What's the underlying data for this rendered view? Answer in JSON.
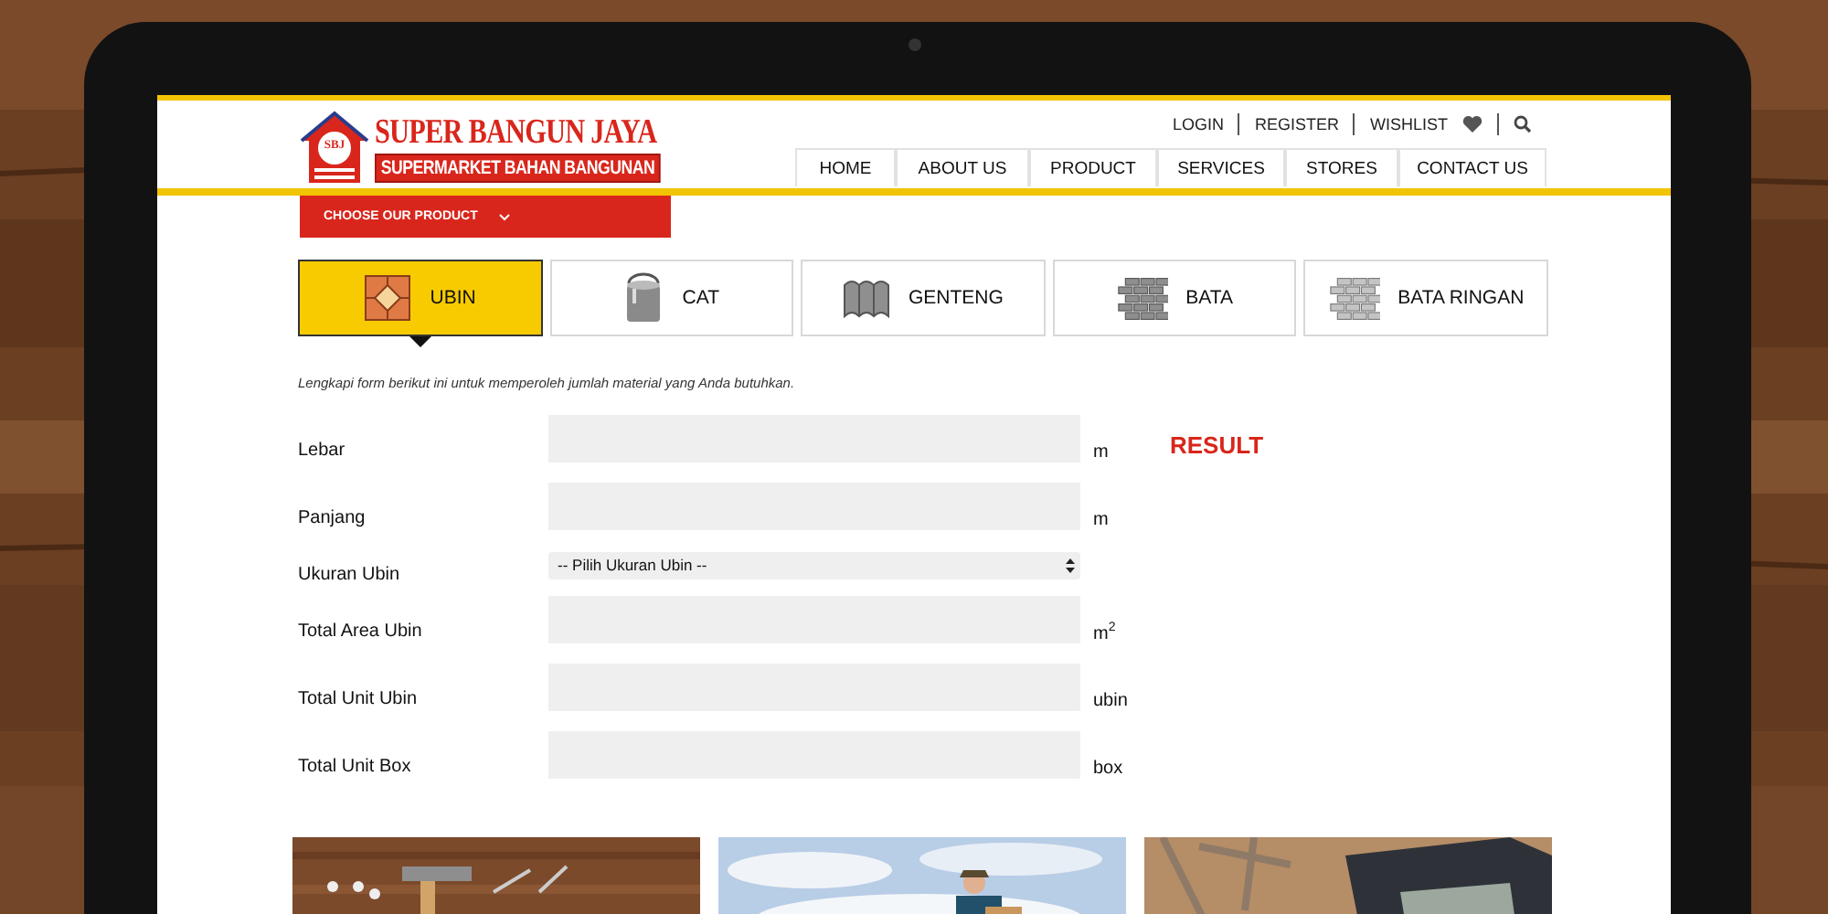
{
  "logo": {
    "title": "SUPER BANGUN JAYA",
    "subtitle": "SUPERMARKET BAHAN BANGUNAN",
    "mark": "SBJ"
  },
  "top_links": [
    {
      "label": "LOGIN",
      "kind": "text"
    },
    {
      "label": "REGISTER",
      "kind": "text"
    },
    {
      "label": "WISHLIST",
      "kind": "heart"
    },
    {
      "kind": "search"
    }
  ],
  "nav": [
    {
      "label": "HOME"
    },
    {
      "label": "ABOUT US"
    },
    {
      "label": "PRODUCT"
    },
    {
      "label": "SERVICES"
    },
    {
      "label": "STORES"
    },
    {
      "label": "CONTACT US"
    }
  ],
  "choose_button": {
    "label": "CHOOSE OUR PRODUCT"
  },
  "product_tabs": [
    {
      "label": "UBIN",
      "kind": "tile",
      "selected": true
    },
    {
      "label": "CAT",
      "kind": "paint",
      "selected": false
    },
    {
      "label": "GENTENG",
      "kind": "roof",
      "selected": false
    },
    {
      "label": "BATA",
      "kind": "brick",
      "selected": false
    },
    {
      "label": "BATA RINGAN",
      "kind": "light-brick",
      "selected": false
    }
  ],
  "instruction": "Lengkapi form berikut ini untuk memperoleh jumlah material yang Anda butuhkan.",
  "form": [
    {
      "label": "Lebar",
      "kind": "input",
      "unit": "m"
    },
    {
      "label": "Panjang",
      "kind": "input",
      "unit": "m"
    },
    {
      "label": "Ukuran Ubin",
      "kind": "select",
      "placeholder": "-- Pilih Ukuran Ubin --"
    },
    {
      "label": "Total Area Ubin",
      "kind": "input",
      "unit": "m$^{2}$"
    },
    {
      "label": "Total Unit Ubin",
      "kind": "input",
      "unit": "ubin"
    },
    {
      "label": "Total Unit Box",
      "kind": "input",
      "unit": "box"
    }
  ],
  "result": {
    "title": "RESULT"
  }
}
